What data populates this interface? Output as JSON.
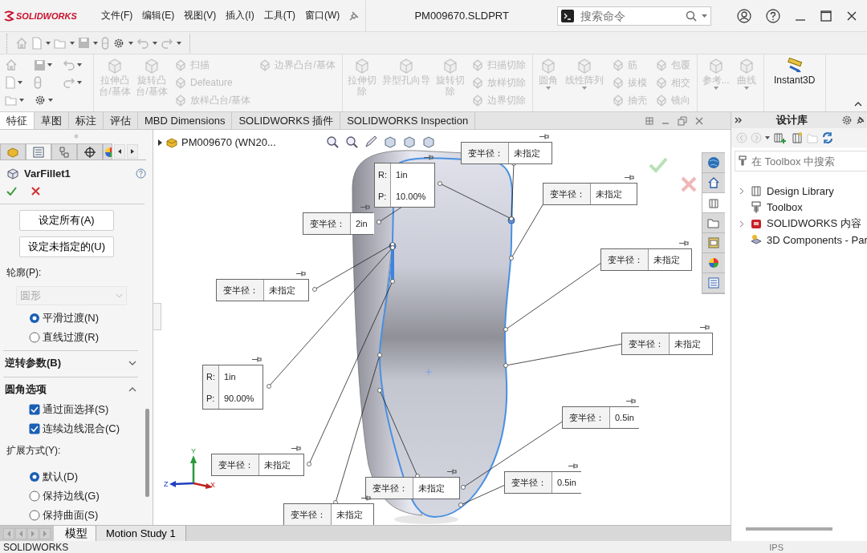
{
  "title_bar": {
    "logo": "SOLIDWORKS",
    "menu": [
      "文件(F)",
      "编辑(E)",
      "视图(V)",
      "插入(I)",
      "工具(T)",
      "窗口(W)"
    ],
    "document_title": "PM009670.SLDPRT",
    "search": {
      "placeholder": "搜索命令"
    }
  },
  "command_manager": {
    "groups": [
      {
        "items": [
          {
            "kind": "large",
            "label": "拉伸凸台/基体",
            "disabled": true
          },
          {
            "kind": "large",
            "label": "旋转凸台/基体",
            "disabled": true
          },
          {
            "kind": "small",
            "label": "扫描",
            "disabled": true
          },
          {
            "kind": "small",
            "label": "Defeature",
            "disabled": true
          },
          {
            "kind": "small",
            "label": "放样凸台/基体",
            "disabled": true
          },
          {
            "kind": "small",
            "label": "边界凸台/基体",
            "disabled": true
          }
        ]
      },
      {
        "items": [
          {
            "kind": "large",
            "label": "拉伸切除",
            "disabled": true
          },
          {
            "kind": "large",
            "label": "异型孔向导",
            "disabled": true
          },
          {
            "kind": "large",
            "label": "旋转切除",
            "disabled": true
          },
          {
            "kind": "small",
            "label": "扫描切除",
            "disabled": true
          },
          {
            "kind": "small",
            "label": "放样切除",
            "disabled": true
          },
          {
            "kind": "small",
            "label": "边界切除",
            "disabled": true
          }
        ]
      },
      {
        "items": [
          {
            "kind": "large",
            "label": "圆角",
            "disabled": true
          },
          {
            "kind": "large",
            "label": "线性阵列",
            "disabled": true
          },
          {
            "kind": "small",
            "label": "筋",
            "disabled": true
          },
          {
            "kind": "small",
            "label": "拔模",
            "disabled": true
          },
          {
            "kind": "small",
            "label": "抽壳",
            "disabled": true
          },
          {
            "kind": "small",
            "label": "包覆",
            "disabled": true
          },
          {
            "kind": "small",
            "label": "相交",
            "disabled": true
          },
          {
            "kind": "small",
            "label": "镜向",
            "disabled": true
          }
        ]
      },
      {
        "items": [
          {
            "kind": "large",
            "label": "参考...",
            "disabled": true
          },
          {
            "kind": "large",
            "label": "曲线",
            "disabled": true
          }
        ]
      },
      {
        "items": [
          {
            "kind": "large",
            "label": "Instant3D",
            "disabled": false
          }
        ]
      }
    ]
  },
  "tabs": [
    {
      "label": "特征",
      "selected": true
    },
    {
      "label": "草图",
      "selected": false
    },
    {
      "label": "标注",
      "selected": false
    },
    {
      "label": "评估",
      "selected": false
    },
    {
      "label": "MBD Dimensions",
      "selected": false
    },
    {
      "label": "SOLIDWORKS 插件",
      "selected": false
    },
    {
      "label": "SOLIDWORKS Inspection",
      "selected": false
    }
  ],
  "property_manager": {
    "panel_tabs": [
      {
        "selected": false
      },
      {
        "selected": true
      },
      {
        "selected": false
      },
      {
        "selected": false
      },
      {
        "selected": false
      }
    ],
    "title": "VarFillet1",
    "items": [
      {
        "kind": "button",
        "label": "设定所有(A)"
      },
      {
        "kind": "button",
        "label": "设定未指定的(U)"
      },
      {
        "kind": "label",
        "label": "轮廓(P):"
      },
      {
        "kind": "dropdown",
        "value": "圆形",
        "disabled": true
      },
      {
        "kind": "radio",
        "label": "平滑过渡(N)",
        "selected": true
      },
      {
        "kind": "radio",
        "label": "直线过渡(R)",
        "selected": false
      },
      {
        "kind": "section",
        "title": "逆转参数(B)",
        "expanded": false
      },
      {
        "kind": "section",
        "title": "圆角选项",
        "expanded": true
      },
      {
        "kind": "checkbox",
        "label": "通过面选择(S)",
        "checked": true
      },
      {
        "kind": "checkbox",
        "label": "连续边线混合(C)",
        "checked": true
      },
      {
        "kind": "label",
        "label": "扩展方式(Y):"
      },
      {
        "kind": "radio2",
        "label": "默认(D)",
        "selected": true
      },
      {
        "kind": "radio2",
        "label": "保持边线(G)",
        "selected": false
      },
      {
        "kind": "radio2",
        "label": "保持曲面(S)",
        "selected": false
      }
    ]
  },
  "graphics": {
    "tree_root": "PM009670 (WN20...",
    "callouts": [
      {
        "kind": "radius",
        "label": "变半径：",
        "value": "未指定"
      },
      {
        "kind": "rp",
        "r_label": "R:",
        "r_value": "1in",
        "p_label": "P:",
        "p_value": "10.00%"
      },
      {
        "kind": "radius",
        "label": "变半径：",
        "value": "未指定"
      },
      {
        "kind": "radius",
        "label": "变半径：",
        "value": "2in"
      },
      {
        "kind": "radius",
        "label": "变半径：",
        "value": "未指定"
      },
      {
        "kind": "radius",
        "label": "变半径：",
        "value": "未指定"
      },
      {
        "kind": "radius",
        "label": "变半径：",
        "value": "未指定"
      },
      {
        "kind": "rp",
        "r_label": "R:",
        "r_value": "1in",
        "p_label": "P:",
        "p_value": "90.00%"
      },
      {
        "kind": "radius",
        "label": "变半径：",
        "value": "0.5in"
      },
      {
        "kind": "radius",
        "label": "变半径：",
        "value": "未指定"
      },
      {
        "kind": "radius",
        "label": "变半径：",
        "value": "未指定"
      },
      {
        "kind": "radius",
        "label": "变半径：",
        "value": "0.5in"
      },
      {
        "kind": "radius",
        "label": "变半径：",
        "value": "未指定"
      }
    ],
    "triad_labels": [
      "Y",
      "Z",
      "X"
    ],
    "task_pane_tabs": [
      {
        "selected": false
      },
      {
        "selected": false
      },
      {
        "selected": true
      },
      {
        "selected": false
      },
      {
        "selected": false
      },
      {
        "selected": false
      },
      {
        "selected": false
      }
    ]
  },
  "design_library": {
    "title": "设计库",
    "search": {
      "placeholder": "在 Toolbox 中搜索"
    },
    "tree": [
      {
        "label": "Design Library",
        "has_children": true
      },
      {
        "label": "Toolbox",
        "has_children": false
      },
      {
        "label": "SOLIDWORKS 内容",
        "has_children": true
      },
      {
        "label": "3D Components - Par",
        "has_children": false
      }
    ]
  },
  "bottom_tabs": [
    {
      "label": "模型",
      "selected": true
    },
    {
      "label": "Motion Study 1",
      "selected": false
    }
  ],
  "status_bar": {
    "app": "SOLIDWORKS",
    "units": "IPS"
  }
}
